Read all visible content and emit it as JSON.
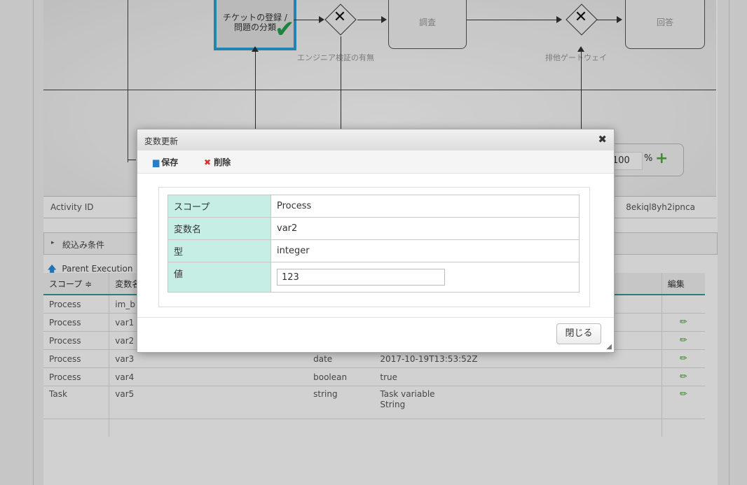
{
  "diagram": {
    "task_register": "チケットの登録 / 問題の分類",
    "task_investigate": "調査",
    "task_answer": "回答",
    "gateway1_label": "エンジニア検証の有無",
    "gateway2_label": "排他ゲートウェイ",
    "gateway_symbol": "✕",
    "check_icon": "✔",
    "zoom_value": "100",
    "zoom_unit": "%",
    "zoom_plus": "+"
  },
  "activity": {
    "label": "Activity ID",
    "value": "8ekiql8yh2ipnca"
  },
  "filter": {
    "arrow": "▸",
    "label": "絞込み条件"
  },
  "parent_execution": {
    "icon": "🡅",
    "label": "Parent Execution"
  },
  "table": {
    "headers": [
      "スコープ ≑",
      "変数名",
      "",
      "",
      "編集"
    ],
    "rows": [
      {
        "scope": "Process",
        "name": "im_b",
        "type": "",
        "value": "",
        "editable": false
      },
      {
        "scope": "Process",
        "name": "var1",
        "type": "",
        "value": "",
        "editable": true
      },
      {
        "scope": "Process",
        "name": "var2",
        "type": "",
        "value": "",
        "editable": true
      },
      {
        "scope": "Process",
        "name": "var3",
        "type": "date",
        "value": "2017-10-19T13:53:52Z",
        "editable": true
      },
      {
        "scope": "Process",
        "name": "var4",
        "type": "boolean",
        "value": "true",
        "editable": true
      },
      {
        "scope": "Task",
        "name": "var5",
        "type": "string",
        "value": "Task variable\nString",
        "editable": true
      }
    ],
    "edit_icon": "✏"
  },
  "dialog": {
    "title": "変数更新",
    "close_icon": "✖",
    "save_label": "保存",
    "delete_label": "削除",
    "delete_icon": "✖",
    "fields": {
      "scope_label": "スコープ",
      "scope_value": "Process",
      "name_label": "変数名",
      "name_value": "var2",
      "type_label": "型",
      "type_value": "integer",
      "value_label": "値",
      "value_value": "123"
    },
    "close_button": "閉じる"
  }
}
